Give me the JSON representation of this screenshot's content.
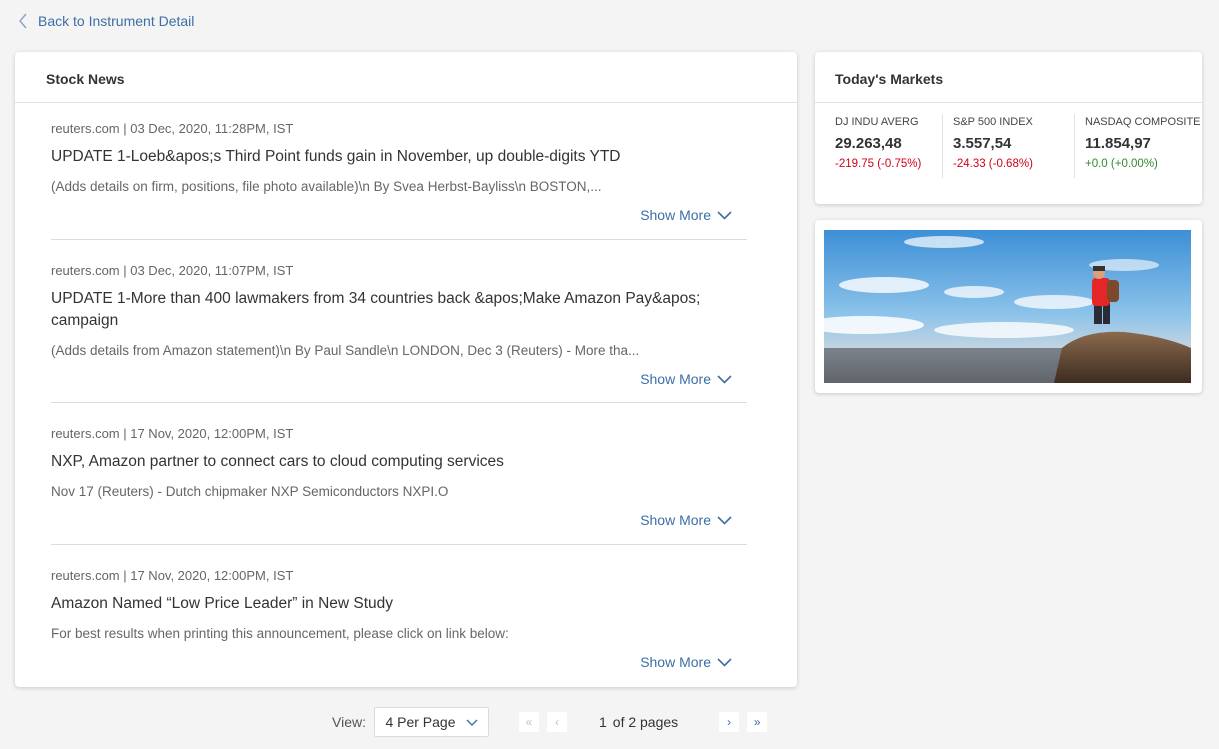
{
  "back_link": {
    "label": "Back to Instrument Detail"
  },
  "news": {
    "title": "Stock News",
    "show_more_label": "Show More",
    "items": [
      {
        "meta": "reuters.com | 03 Dec, 2020, 11:28PM, IST",
        "title": "UPDATE 1-Loeb&apos;s Third Point funds gain in November, up double-digits YTD",
        "snippet": " (Adds details on firm, positions, file photo available)\\n    By Svea Herbst-Bayliss\\n    BOSTON,..."
      },
      {
        "meta": "reuters.com | 03 Dec, 2020, 11:07PM, IST",
        "title": "UPDATE 1-More than 400 lawmakers from 34 countries back &apos;Make Amazon Pay&apos; campaign",
        "snippet": " (Adds details from Amazon statement)\\n    By Paul Sandle\\n    LONDON, Dec 3 (Reuters) - More tha..."
      },
      {
        "meta": "reuters.com | 17 Nov, 2020, 12:00PM, IST",
        "title": "NXP, Amazon partner to connect cars to cloud computing services",
        "snippet": "    Nov 17 (Reuters) - Dutch chipmaker NXP Semiconductors NXPI.O"
      },
      {
        "meta": "reuters.com | 17 Nov, 2020, 12:00PM, IST",
        "title": "Amazon Named “Low Price Leader” in New Study",
        "snippet": "For best results when printing this announcement, please click on link below:"
      }
    ]
  },
  "markets": {
    "title": "Today's Markets",
    "indices": [
      {
        "name": "DJ INDU AVERG",
        "value": "29.263,48",
        "change": "-219.75 (-0.75%)",
        "direction": "down"
      },
      {
        "name": "S&P 500 INDEX",
        "value": "3.557,54",
        "change": "-24.33 (-0.68%)",
        "direction": "down"
      },
      {
        "name": "NASDAQ COMPOSITE",
        "value": "11.854,97",
        "change": "+0.0 (+0.00%)",
        "direction": "up"
      }
    ],
    "colors": {
      "negative": "#d0021b",
      "positive": "#2e8b2e"
    }
  },
  "pagination": {
    "view_label": "View:",
    "per_page": "4 Per Page",
    "current_page": "1",
    "of_pages": "of 2 pages"
  },
  "theme": {
    "accent": "#3c6ea8"
  }
}
